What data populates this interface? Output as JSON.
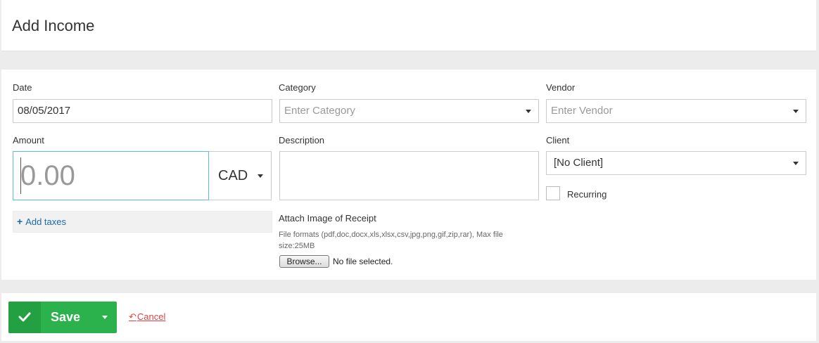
{
  "header": {
    "title": "Add Income"
  },
  "form": {
    "date": {
      "label": "Date",
      "value": "08/05/2017"
    },
    "category": {
      "label": "Category",
      "placeholder": "Enter Category"
    },
    "vendor": {
      "label": "Vendor",
      "placeholder": "Enter Vendor"
    },
    "amount": {
      "label": "Amount",
      "placeholder": "0.00",
      "currency": "CAD"
    },
    "description": {
      "label": "Description"
    },
    "client": {
      "label": "Client",
      "value": "[No Client]"
    },
    "recurring": {
      "label": "Recurring",
      "checked": false
    },
    "taxes": {
      "icon": "plus-icon",
      "label": "Add taxes"
    },
    "receipt": {
      "label": "Attach Image of Receipt",
      "formats": "File formats (pdf,doc,docx,xls,xlsx,csv,jpg,png,gif,zip,rar), Max file size:25MB",
      "browse_label": "Browse...",
      "no_file": "No file selected."
    }
  },
  "footer": {
    "save_label": "Save",
    "cancel_label": "Cancel"
  },
  "colors": {
    "save_green": "#2bb24c",
    "save_dark_green": "#22a042",
    "link_blue": "#1b6aa8",
    "cancel_red": "#e04343",
    "focus_border": "#5bc0de"
  }
}
